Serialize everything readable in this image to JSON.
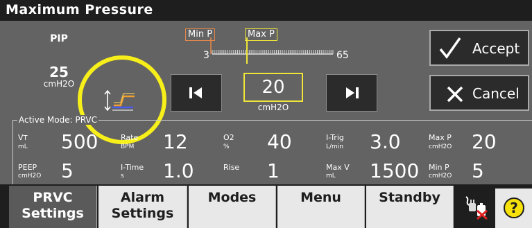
{
  "title": "Maximum Pressure",
  "pip": {
    "label": "PIP",
    "value": "25",
    "unit": "cmH2O"
  },
  "scale": {
    "min_label": "Min P",
    "max_label": "Max P",
    "min": "3",
    "max": "65"
  },
  "setting": {
    "value": "20",
    "unit": "cmH2O"
  },
  "buttons": {
    "accept": "Accept",
    "cancel": "Cancel"
  },
  "active_mode": "Active Mode: PRVC",
  "params": {
    "vt": {
      "label": "V",
      "label_sub": "T",
      "unit": "mL",
      "value": "500"
    },
    "rate": {
      "label": "Rate",
      "unit": "BPM",
      "value": "12"
    },
    "o2": {
      "label": "O2",
      "unit": "%",
      "value": "40"
    },
    "itrig": {
      "label": "I-Trig",
      "unit": "L/min",
      "value": "3.0"
    },
    "maxp": {
      "label": "Max P",
      "unit": "cmH2O",
      "value": "20"
    },
    "peep": {
      "label": "PEEP",
      "unit": "cmH2O",
      "value": "5"
    },
    "itime": {
      "label": "I-Time",
      "unit": "s",
      "value": "1.0"
    },
    "rise": {
      "label": "Rise",
      "unit": "",
      "value": "1"
    },
    "maxv": {
      "label": "Max V",
      "unit": "mL",
      "value": "1500"
    },
    "minp": {
      "label": "Min P",
      "unit": "cmH2O",
      "value": "5"
    }
  },
  "tabs": {
    "prvc": {
      "line1": "PRVC",
      "line2": "Settings"
    },
    "alarm": {
      "line1": "Alarm",
      "line2": "Settings"
    },
    "modes": {
      "line1": "Modes"
    },
    "menu": {
      "line1": "Menu"
    },
    "standby": {
      "line1": "Standby"
    }
  },
  "help_symbol": "?",
  "icons": [
    "up-down-arrow-icon",
    "pressure-waveform-icon",
    "skip-back-icon",
    "skip-forward-icon",
    "checkmark-icon",
    "x-icon",
    "power-plug-icon",
    "help-icon"
  ],
  "colors": {
    "highlight_yellow": "#f7ef1a",
    "min_orange": "#e8874a",
    "max_yellow": "#f0e63a",
    "background": "#636363",
    "title_bar": "#1e1e1e"
  }
}
